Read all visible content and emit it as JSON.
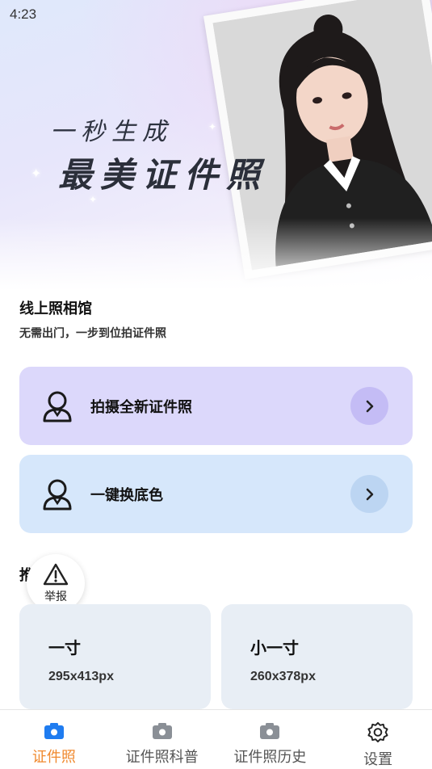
{
  "status_bar": {
    "time": "4:23"
  },
  "hero": {
    "slogan_line1": "一秒生成",
    "slogan_line2": "最美证件照"
  },
  "studio": {
    "title": "线上照相馆",
    "subtitle": "无需出门，一步到位拍证件照",
    "actions": [
      {
        "label": "拍摄全新证件照",
        "icon": "person-outline-icon",
        "color": "#dcd8fb"
      },
      {
        "label": "一键换底色",
        "icon": "person-outline-icon",
        "color": "#d6e7fb"
      }
    ]
  },
  "sizes_section": {
    "title": "推荐尺寸",
    "items": [
      {
        "name": "一寸",
        "dims": "295x413px"
      },
      {
        "name": "小一寸",
        "dims": "260x378px"
      }
    ]
  },
  "report": {
    "label": "举报",
    "icon": "warning-triangle-icon"
  },
  "bottom_nav": {
    "active_color": "#f0892e",
    "items": [
      {
        "label": "证件照",
        "icon": "camera-icon",
        "active": true
      },
      {
        "label": "证件照科普",
        "icon": "camera-icon",
        "active": false
      },
      {
        "label": "证件照历史",
        "icon": "camera-icon",
        "active": false
      },
      {
        "label": "设置",
        "icon": "gear-icon",
        "active": false
      }
    ]
  }
}
